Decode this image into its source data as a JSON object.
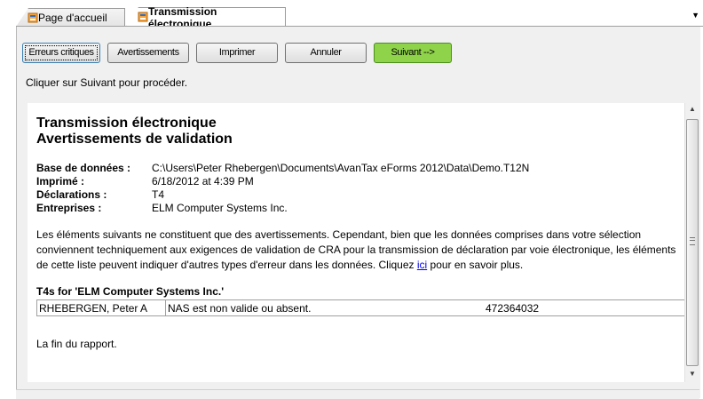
{
  "tabs": [
    {
      "label": "Page d'accueil",
      "active": false,
      "icon": "report-icon"
    },
    {
      "label": "Transmission électronique",
      "active": true,
      "icon": "report-icon"
    }
  ],
  "toolbar": {
    "critical_errors_label": "Erreurs critiques",
    "warnings_label": "Avertissements",
    "print_label": "Imprimer",
    "cancel_label": "Annuler",
    "next_label": "Suivant -->"
  },
  "instruction": "Cliquer sur Suivant pour procéder.",
  "report": {
    "title_line1": "Transmission électronique",
    "title_line2": "Avertissements de validation",
    "meta": [
      {
        "label": "Base de données :",
        "value": "C:\\Users\\Peter Rhebergen\\Documents\\AvanTax eForms 2012\\Data\\Demo.T12N"
      },
      {
        "label": "Imprimé :",
        "value": "6/18/2012 at 4:39 PM"
      },
      {
        "label": "Déclarations :",
        "value": "T4"
      },
      {
        "label": "Entreprises :",
        "value": "ELM Computer Systems Inc."
      }
    ],
    "paragraph_before_link": "Les éléments suivants ne constituent que des avertissements. Cependant, bien que les données comprises dans votre sélection conviennent techniquement aux exigences de validation de CRA pour la transmission de déclaration par voie électronique, les éléments de cette liste peuvent indiquer d'autres types d'erreur dans les données. Cliquez ",
    "link_text": "ici",
    "paragraph_after_link": " pour en savoir plus.",
    "section_title": "T4s for 'ELM Computer Systems Inc.'",
    "warnings": [
      {
        "name": "RHEBERGEN, Peter A",
        "message": "NAS est non valide ou absent.",
        "value": "472364032"
      }
    ],
    "end_text": "La fin du rapport."
  },
  "colors": {
    "accent_button": "#8fd34a",
    "link": "#0000ee",
    "panel_background": "#f0f0f0"
  }
}
